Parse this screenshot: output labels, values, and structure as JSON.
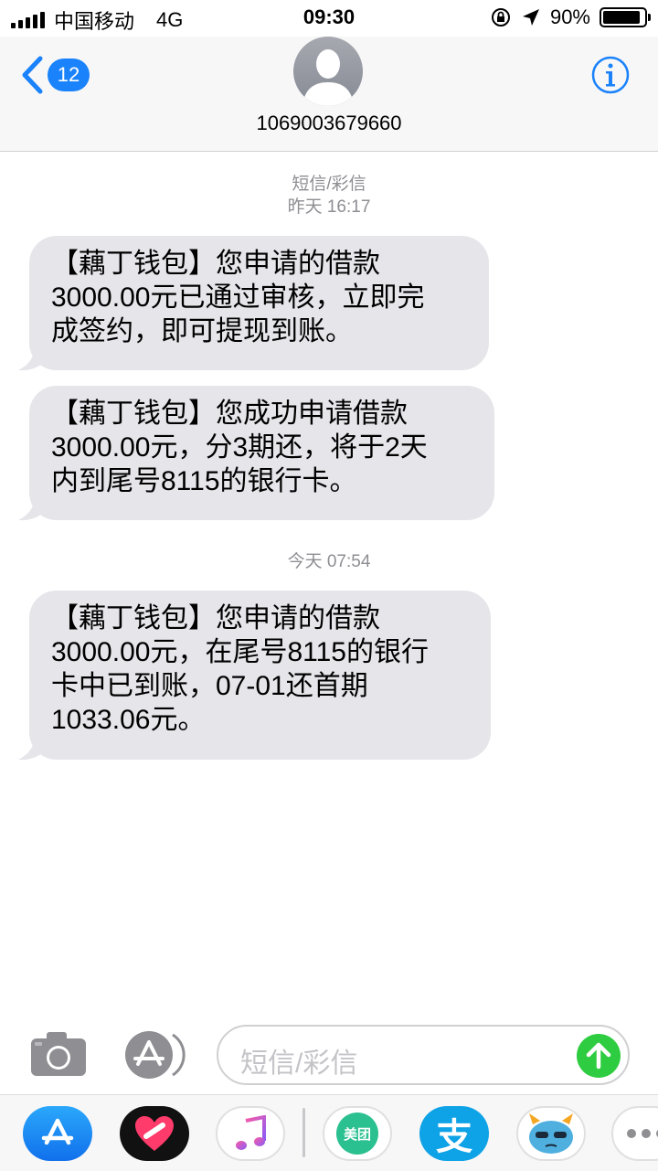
{
  "status_bar": {
    "carrier": "中国移动",
    "network": "4G",
    "time": "09:30",
    "battery_percent": "90%",
    "battery_level": 0.9
  },
  "header": {
    "back_badge": "12",
    "contact_name": "1069003679660",
    "accent_color": "#1a82fb"
  },
  "thread": {
    "label": "短信/彩信",
    "timestamp_1": "昨天 16:17",
    "timestamp_2": "今天 07:54"
  },
  "messages": [
    {
      "text": "【藕丁钱包】您申请的借款\n3000.00元已通过审核，立即完\n成签约，即可提现到账。"
    },
    {
      "text": "【藕丁钱包】您成功申请借款\n3000.00元，分3期还，将于2天\n内到尾号8115的银行卡。"
    },
    {
      "text": "【藕丁钱包】您申请的借款\n3000.00元，在尾号8115的银行\n卡中已到账，07-01还首期\n1033.06元。"
    }
  ],
  "input_bar": {
    "placeholder": "短信/彩信",
    "send_color": "#2ecc40"
  },
  "app_drawer": {
    "apps": [
      {
        "name": "app-store-icon"
      },
      {
        "name": "health-heart-icon"
      },
      {
        "name": "music-icon"
      },
      {
        "name": "meituan-icon",
        "label": "美团"
      },
      {
        "name": "alipay-icon",
        "label": "支"
      },
      {
        "name": "monster-sticker-icon"
      },
      {
        "name": "more-icon"
      }
    ]
  }
}
